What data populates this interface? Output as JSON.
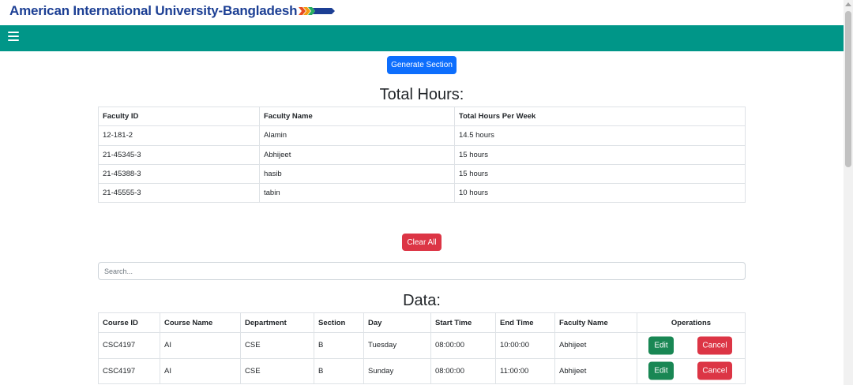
{
  "brand": {
    "name": "American International University-Bangladesh"
  },
  "actions": {
    "generate": "Generate Section",
    "clear_all": "Clear All"
  },
  "hours": {
    "title": "Total Hours:",
    "headers": [
      "Faculty ID",
      "Faculty Name",
      "Total Hours Per Week"
    ],
    "rows": [
      [
        "12-181-2",
        "Alamin",
        "14.5 hours"
      ],
      [
        "21-45345-3",
        "Abhijeet",
        "15 hours"
      ],
      [
        "21-45388-3",
        "hasib",
        "15 hours"
      ],
      [
        "21-45555-3",
        "tabin",
        "10 hours"
      ]
    ]
  },
  "search": {
    "placeholder": "Search..."
  },
  "data": {
    "title": "Data:",
    "headers": [
      "Course ID",
      "Course Name",
      "Department",
      "Section",
      "Day",
      "Start Time",
      "End Time",
      "Faculty Name",
      "Operations"
    ],
    "rows": [
      {
        "course_id": "CSC4197",
        "course_name": "AI",
        "department": "CSE",
        "section": "B",
        "day": "Tuesday",
        "start": "08:00:00",
        "end": "10:00:00",
        "faculty": "Abhijeet",
        "edit": "Edit",
        "cancel": "Cancel"
      },
      {
        "course_id": "CSC4197",
        "course_name": "AI",
        "department": "CSE",
        "section": "B",
        "day": "Sunday",
        "start": "08:00:00",
        "end": "11:00:00",
        "faculty": "Abhijeet",
        "edit": "Edit",
        "cancel": "Cancel"
      }
    ]
  }
}
